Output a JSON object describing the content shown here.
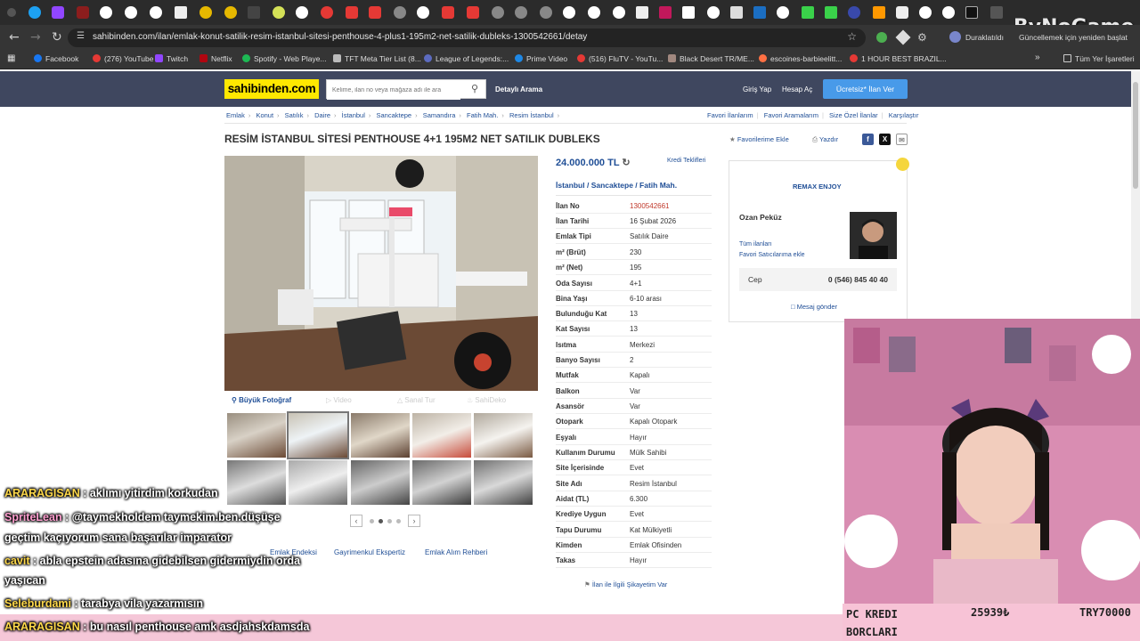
{
  "browser": {
    "url": "sahibinden.com/ilan/emlak-konut-satilik-resim-istanbul-sitesi-penthouse-4-plus1-195m2-net-satilik-dubleks-1300542661/detay",
    "profile_label": "Duraklatıldı",
    "update_label": "Güncellemek için yeniden başlat",
    "bookmarks": [
      "Facebook",
      "(276) YouTube",
      "Twitch",
      "Netflix",
      "Spotify - Web Playe...",
      "TFT Meta Tier List (8...",
      "League of Legends:...",
      "Prime Video",
      "(516) FluTV - YouTu...",
      "Black Desert TR/ME...",
      "escoines-barbieelitt...",
      "1 HOUR BEST BRAZIL..."
    ],
    "all_bookmarks": "Tüm Yer İşaretleri"
  },
  "watermark": "ByNoGame",
  "header": {
    "logo": "sahibinden.com",
    "search_placeholder": "Kelime, ilan no veya mağaza adı ile ara",
    "advanced_search": "Detaylı Arama",
    "login": "Giriş Yap",
    "register": "Hesap Aç",
    "cta": "Ücretsiz* İlan Ver"
  },
  "breadcrumb": [
    "Emlak",
    "Konut",
    "Satılık",
    "Daire",
    "İstanbul",
    "Sancaktepe",
    "Samandıra",
    "Fatih Mah.",
    "Resim İstanbul"
  ],
  "top_links": [
    "Favori İlanlarım",
    "Favori Aramalarım",
    "Size Özel İlanlar",
    "Karşılaştır"
  ],
  "listing": {
    "title": "RESİM İSTANBUL SİTESİ PENTHOUSE 4+1 195M2 NET SATILIK DUBLEKS",
    "add_favorite": "Favorilerime Ekle",
    "print": "Yazdır",
    "price": "24.000.000 TL",
    "credit_offers": "Kredi Teklifleri",
    "location": [
      "İstanbul",
      "Sancaktepe",
      "Fatih Mah."
    ],
    "photo_tools": {
      "big_photo": "Büyük Fotoğraf",
      "video": "Video",
      "virtual_tour": "Sanal Tur",
      "sahideko": "SahiDeko"
    },
    "bottom_links": [
      "Emlak Endeksi",
      "Gayrimenkul Ekspertiz",
      "Emlak Alım Rehberi"
    ],
    "complaint": "İlan ile İlgili Şikayetim Var",
    "details": [
      {
        "k": "İlan No",
        "v": "1300542661"
      },
      {
        "k": "İlan Tarihi",
        "v": "16 Şubat 2026"
      },
      {
        "k": "Emlak Tipi",
        "v": "Satılık Daire"
      },
      {
        "k": "m² (Brüt)",
        "v": "230"
      },
      {
        "k": "m² (Net)",
        "v": "195"
      },
      {
        "k": "Oda Sayısı",
        "v": "4+1"
      },
      {
        "k": "Bina Yaşı",
        "v": "6-10 arası"
      },
      {
        "k": "Bulunduğu Kat",
        "v": "13"
      },
      {
        "k": "Kat Sayısı",
        "v": "13"
      },
      {
        "k": "Isıtma",
        "v": "Merkezi"
      },
      {
        "k": "Banyo Sayısı",
        "v": "2"
      },
      {
        "k": "Mutfak",
        "v": "Kapalı"
      },
      {
        "k": "Balkon",
        "v": "Var"
      },
      {
        "k": "Asansör",
        "v": "Var"
      },
      {
        "k": "Otopark",
        "v": "Kapalı Otopark"
      },
      {
        "k": "Eşyalı",
        "v": "Hayır"
      },
      {
        "k": "Kullanım Durumu",
        "v": "Mülk Sahibi"
      },
      {
        "k": "Site İçerisinde",
        "v": "Evet"
      },
      {
        "k": "Site Adı",
        "v": "Resim İstanbul"
      },
      {
        "k": "Aidat (TL)",
        "v": "6.300"
      },
      {
        "k": "Krediye Uygun",
        "v": "Evet"
      },
      {
        "k": "Tapu Durumu",
        "v": "Kat Mülkiyetli"
      },
      {
        "k": "Kimden",
        "v": "Emlak Ofisinden"
      },
      {
        "k": "Takas",
        "v": "Hayır"
      }
    ]
  },
  "seller": {
    "store": "REMAX ENJOY",
    "name": "Ozan Peküz",
    "all_listings": "Tüm ilanları",
    "add_fav_seller": "Favori Satıcılarıma ekle",
    "phone_label": "Cep",
    "phone": "0 (546) 845 40 40",
    "message": "Mesaj gönder"
  },
  "stream": {
    "credit_label": "PC KREDI BORCLARI",
    "credit_value": "25939₺",
    "credit_try": "TRY70000",
    "chat": [
      {
        "user": "ARARAGISAN",
        "msg": ": aklımı yitirdim korkudan"
      },
      {
        "user": "SpriteLean",
        "msg": ": @taymekholdem taymekim.ben.düşüşe"
      },
      {
        "user": "",
        "msg": "geçtim kaçıyorum sana başarılar imparator"
      },
      {
        "user": "cavit",
        "msg": ": abla epstein adasına gidebilsen gidermiydin orda"
      },
      {
        "user": "",
        "msg": "yaşıcan"
      },
      {
        "user": "Seleburdami",
        "msg": ": tarabya vila yazarmısın"
      },
      {
        "user": "ARARAGISAN",
        "msg": ": bu nasıl penthouse amk asdjahskdamsda"
      }
    ]
  },
  "colors": {
    "header": "#3f475f",
    "logo_bg": "#ffe800",
    "cta": "#489ae9",
    "link": "#1f4e96",
    "ilan_no": "#c0392b"
  }
}
